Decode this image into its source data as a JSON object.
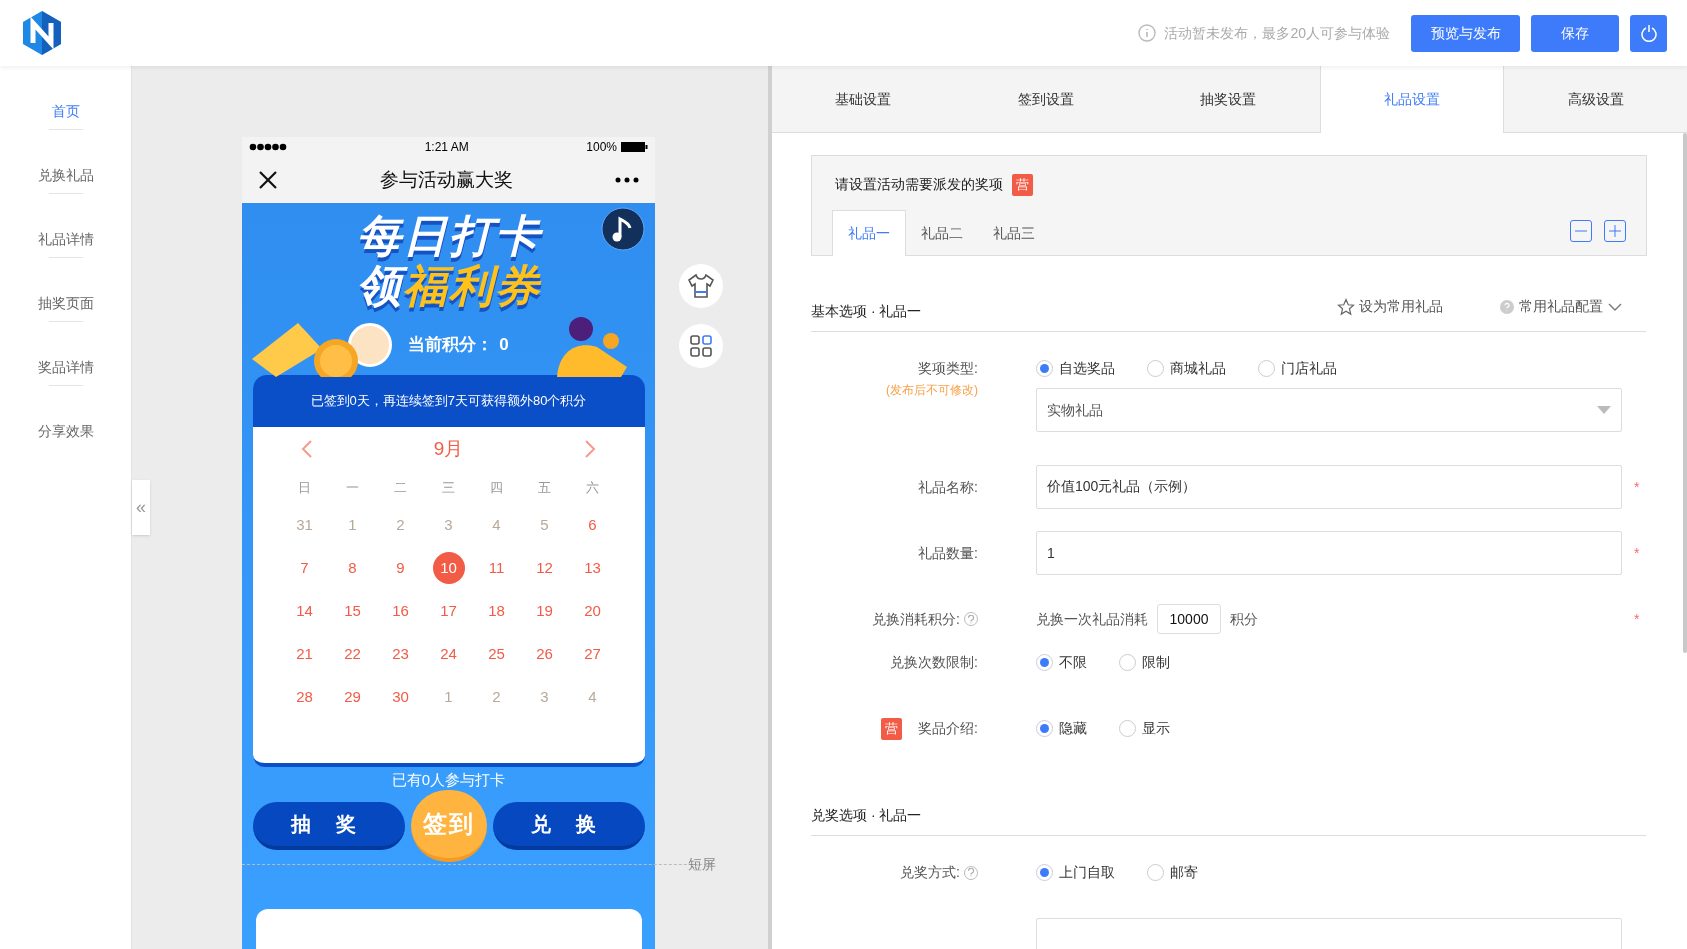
{
  "header": {
    "notice": "活动暂未发布，最多20人可参与体验",
    "buttons": [
      {
        "label": "预览与发布"
      },
      {
        "label": "保存"
      }
    ]
  },
  "sidebar": {
    "items": [
      {
        "label": "首页",
        "selected": true
      },
      {
        "label": "兑换礼品",
        "selected": false
      },
      {
        "label": "礼品详情",
        "selected": false
      },
      {
        "label": "抽奖页面",
        "selected": false
      },
      {
        "label": "奖品详情",
        "selected": false
      },
      {
        "label": "分享效果",
        "selected": false
      }
    ],
    "collapse": "«"
  },
  "phone": {
    "time": "1:21 AM",
    "battery": "100%",
    "nav_title": "参与活动赢大奖",
    "banner": {
      "line_1": "每日打卡",
      "line_2_plain": "领",
      "line_2_accent": "福利券"
    },
    "score": {
      "label": "当前积分：",
      "value": "0"
    },
    "progress_text": "已签到0天，再连续签到7天可获得额外80个积分",
    "calendar": {
      "month": "9月",
      "weekdays": [
        "日",
        "一",
        "二",
        "三",
        "四",
        "五",
        "六"
      ],
      "days": [
        {
          "label": "31",
          "kind": "other"
        },
        {
          "label": "1",
          "kind": "other"
        },
        {
          "label": "2",
          "kind": "other"
        },
        {
          "label": "3",
          "kind": "other"
        },
        {
          "label": "4",
          "kind": "other"
        },
        {
          "label": "5",
          "kind": "other"
        },
        {
          "label": "6",
          "kind": "current"
        },
        {
          "label": "7",
          "kind": "current"
        },
        {
          "label": "8",
          "kind": "current"
        },
        {
          "label": "9",
          "kind": "current"
        },
        {
          "label": "10",
          "kind": "today"
        },
        {
          "label": "11",
          "kind": "current"
        },
        {
          "label": "12",
          "kind": "current"
        },
        {
          "label": "13",
          "kind": "current"
        },
        {
          "label": "14",
          "kind": "current"
        },
        {
          "label": "15",
          "kind": "current"
        },
        {
          "label": "16",
          "kind": "current"
        },
        {
          "label": "17",
          "kind": "current"
        },
        {
          "label": "18",
          "kind": "current"
        },
        {
          "label": "19",
          "kind": "current"
        },
        {
          "label": "20",
          "kind": "current"
        },
        {
          "label": "21",
          "kind": "current"
        },
        {
          "label": "22",
          "kind": "current"
        },
        {
          "label": "23",
          "kind": "current"
        },
        {
          "label": "24",
          "kind": "current"
        },
        {
          "label": "25",
          "kind": "current"
        },
        {
          "label": "26",
          "kind": "current"
        },
        {
          "label": "27",
          "kind": "current"
        },
        {
          "label": "28",
          "kind": "current"
        },
        {
          "label": "29",
          "kind": "current"
        },
        {
          "label": "30",
          "kind": "current"
        },
        {
          "label": "1",
          "kind": "other"
        },
        {
          "label": "2",
          "kind": "other"
        },
        {
          "label": "3",
          "kind": "other"
        },
        {
          "label": "4",
          "kind": "other"
        }
      ]
    },
    "participants": "已有0人参与打卡",
    "actions": [
      {
        "label": "抽 奖",
        "kind": "side"
      },
      {
        "label": "签到",
        "kind": "primary"
      },
      {
        "label": "兑 换",
        "kind": "side"
      }
    ],
    "fold_label": "短屏"
  },
  "settings": {
    "tabs": [
      {
        "label": "基础设置",
        "selected": false
      },
      {
        "label": "签到设置",
        "selected": false
      },
      {
        "label": "抽奖设置",
        "selected": false
      },
      {
        "label": "礼品设置",
        "selected": true
      },
      {
        "label": "高级设置",
        "selected": false
      }
    ],
    "prize_box": {
      "title": "请设置活动需要派发的奖项",
      "badge": "营",
      "tabs": [
        {
          "label": "礼品一",
          "selected": true
        },
        {
          "label": "礼品二",
          "selected": false
        },
        {
          "label": "礼品三",
          "selected": false
        }
      ]
    },
    "sections": [
      {
        "title": "基本选项 · 礼品一",
        "favorite": "设为常用礼品",
        "config": "常用礼品配置",
        "fields": [
          {
            "kind": "radio",
            "label": "奖项类型:",
            "note": "(发布后不可修改)",
            "options": [
              {
                "label": "自选奖品",
                "selected": true
              },
              {
                "label": "商城礼品",
                "selected": false
              },
              {
                "label": "门店礼品",
                "selected": false
              }
            ]
          },
          {
            "kind": "select",
            "value": "实物礼品"
          },
          {
            "kind": "text",
            "label": "礼品名称:",
            "value": "价值100元礼品（示例）",
            "required_mark": "*"
          },
          {
            "kind": "text",
            "label": "礼品数量:",
            "value": "1",
            "required_mark": "*"
          },
          {
            "kind": "points",
            "label": "兑换消耗积分:",
            "help": true,
            "prefix": "兑换一次礼品消耗",
            "value": "10000",
            "suffix": "积分",
            "required_mark": "*"
          },
          {
            "kind": "radio",
            "label": "兑换次数限制:",
            "options": [
              {
                "label": "不限",
                "selected": true
              },
              {
                "label": "限制",
                "selected": false
              }
            ]
          },
          {
            "kind": "radio",
            "label": "奖品介绍:",
            "badge": "营",
            "options": [
              {
                "label": "隐藏",
                "selected": true
              },
              {
                "label": "显示",
                "selected": false
              }
            ]
          }
        ]
      },
      {
        "title": "兑奖选项 · 礼品一",
        "fields": [
          {
            "kind": "radio",
            "label": "兑奖方式:",
            "help": true,
            "options": [
              {
                "label": "上门自取",
                "selected": true
              },
              {
                "label": "邮寄",
                "selected": false
              }
            ]
          },
          {
            "kind": "blank"
          }
        ]
      }
    ]
  }
}
